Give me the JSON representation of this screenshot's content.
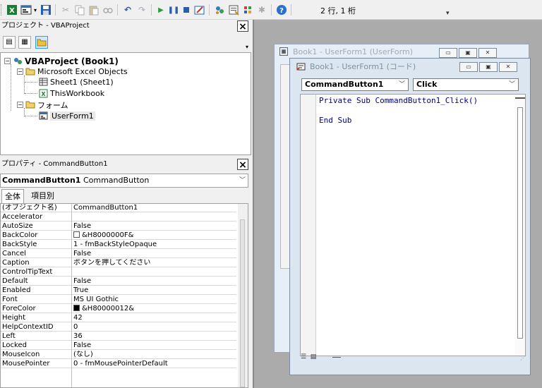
{
  "toolbar": {
    "status_text": "2 行, 1 桁"
  },
  "project_panel": {
    "title": "プロジェクト - VBAProject",
    "close_glyph": "×",
    "tree": {
      "root": "VBAProject (Book1)",
      "excel_objects_folder": "Microsoft Excel Objects",
      "sheet1": "Sheet1 (Sheet1)",
      "thisworkbook": "ThisWorkbook",
      "forms_folder": "フォーム",
      "userform1": "UserForm1"
    }
  },
  "properties_panel": {
    "title": "プロパティ - CommandButton1",
    "close_glyph": "×",
    "object_name": "CommandButton1",
    "object_type": " CommandButton",
    "tab_all": "全体",
    "tab_category": "項目別",
    "rows": [
      {
        "name": "(オブジェクト名)",
        "value": "CommandButton1"
      },
      {
        "name": "Accelerator",
        "value": ""
      },
      {
        "name": "AutoSize",
        "value": "False"
      },
      {
        "name": "BackColor",
        "value": "&H8000000F&",
        "swatch": "#ffffff"
      },
      {
        "name": "BackStyle",
        "value": "1 - fmBackStyleOpaque"
      },
      {
        "name": "Cancel",
        "value": "False"
      },
      {
        "name": "Caption",
        "value": "ボタンを押してください"
      },
      {
        "name": "ControlTipText",
        "value": ""
      },
      {
        "name": "Default",
        "value": "False"
      },
      {
        "name": "Enabled",
        "value": "True"
      },
      {
        "name": "Font",
        "value": "MS UI Gothic"
      },
      {
        "name": "ForeColor",
        "value": "&H80000012&",
        "swatch": "#000000"
      },
      {
        "name": "Height",
        "value": "42"
      },
      {
        "name": "HelpContextID",
        "value": "0"
      },
      {
        "name": "Left",
        "value": "36"
      },
      {
        "name": "Locked",
        "value": "False"
      },
      {
        "name": "MouseIcon",
        "value": "(なし)"
      },
      {
        "name": "MousePointer",
        "value": "0 - fmMousePointerDefault"
      }
    ]
  },
  "userform_window": {
    "title": "Book1 - UserForm1 (UserForm)"
  },
  "code_window": {
    "title": "Book1 - UserForm1 (コード)",
    "object_combo": "CommandButton1",
    "procedure_combo": "Click",
    "lines": [
      "Private Sub CommandButton1_Click()",
      "",
      "End Sub"
    ]
  }
}
